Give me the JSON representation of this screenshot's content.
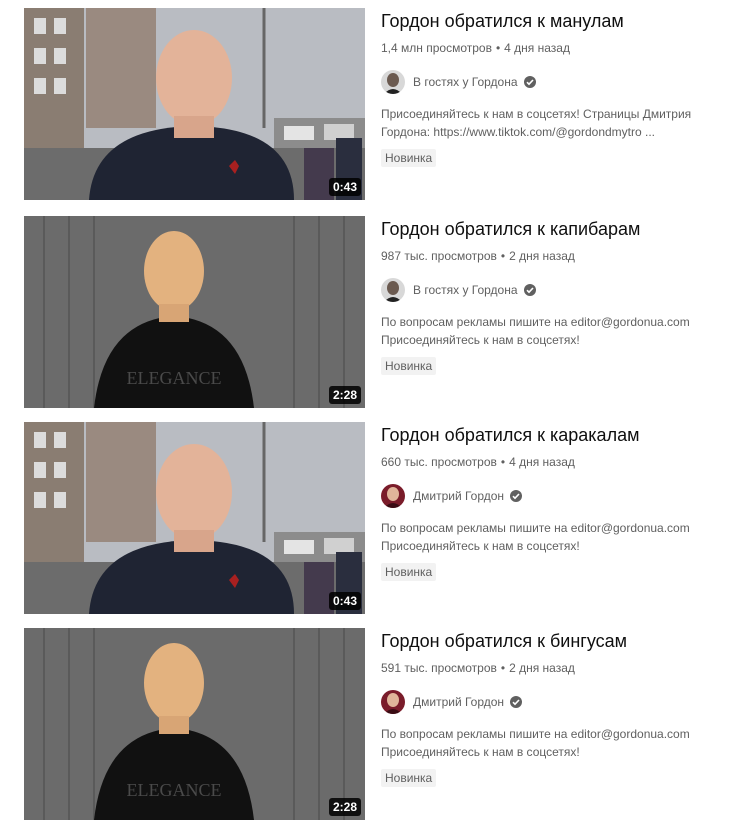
{
  "results": [
    {
      "title": "Гордон обратился к манулам",
      "views": "1,4 млн просмотров",
      "age": "4 дня назад",
      "separator": "•",
      "channel": "В гостях у Гордона",
      "avatar": "light",
      "description": [
        "Присоединяйтесь к нам в соцсетях! Страницы Дмитрия",
        "Гордона: https://www.tiktok.com/@gordondmytro ..."
      ],
      "badge": "Новинка",
      "duration": "0:43",
      "scene": "street"
    },
    {
      "title": "Гордон обратился к капибарам",
      "views": "987 тыс. просмотров",
      "age": "2 дня назад",
      "separator": "•",
      "channel": "В гостях у Гордона",
      "avatar": "light",
      "description": [
        "По вопросам рекламы пишите на editor@gordonua.com",
        "Присоединяйтесь к нам в соцсетях!"
      ],
      "badge": "Новинка",
      "duration": "2:28",
      "scene": "wall",
      "shirt_text": "ELEGANCE"
    },
    {
      "title": "Гордон обратился к каракалам",
      "views": "660 тыс. просмотров",
      "age": "4 дня назад",
      "separator": "•",
      "channel": "Дмитрий Гордон",
      "avatar": "red",
      "description": [
        "По вопросам рекламы пишите на editor@gordonua.com",
        "Присоединяйтесь к нам в соцсетях!"
      ],
      "badge": "Новинка",
      "duration": "0:43",
      "scene": "street"
    },
    {
      "title": "Гордон обратился к бингусам",
      "views": "591 тыс. просмотров",
      "age": "2 дня назад",
      "separator": "•",
      "channel": "Дмитрий Гордон",
      "avatar": "red",
      "description": [
        "По вопросам рекламы пишите на editor@gordonua.com",
        "Присоединяйтесь к нам в соцсетях!"
      ],
      "badge": "Новинка",
      "duration": "2:28",
      "scene": "wall",
      "shirt_text": "ELEGANCE"
    }
  ],
  "icons": {
    "verified": "verified-check-icon"
  },
  "colors": {
    "meta_text": "#606060",
    "title_text": "#0f0f0f",
    "badge_bg": "#f2f2f2"
  }
}
